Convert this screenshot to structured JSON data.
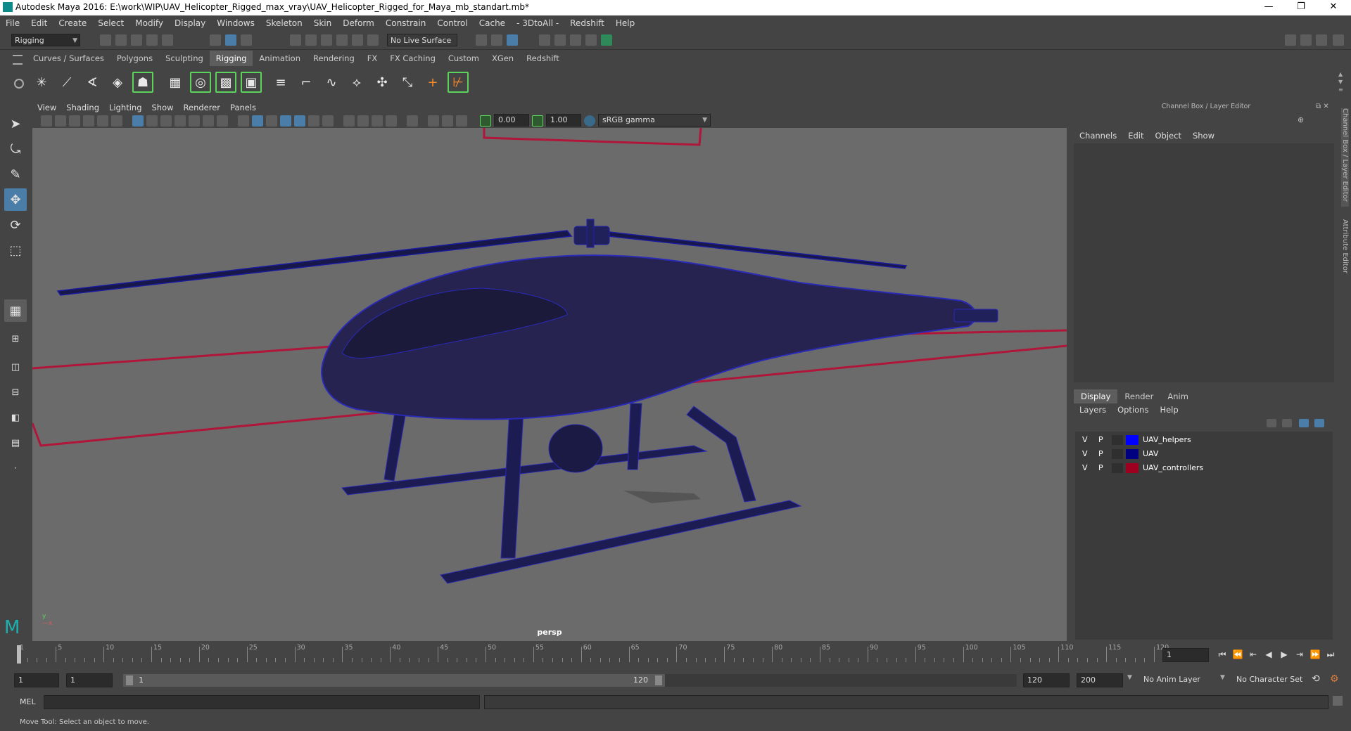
{
  "window": {
    "title": "Autodesk Maya 2016: E:\\work\\WIP\\UAV_Helicopter_Rigged_max_vray\\UAV_Helicopter_Rigged_for_Maya_mb_standart.mb*",
    "minimize": "—",
    "restore": "❐",
    "close": "✕"
  },
  "menubar": [
    "File",
    "Edit",
    "Create",
    "Select",
    "Modify",
    "Display",
    "Windows",
    "Skeleton",
    "Skin",
    "Deform",
    "Constrain",
    "Control",
    "Cache",
    "- 3DtoAll -",
    "Redshift",
    "Help"
  ],
  "statusline": {
    "menuset": "Rigging",
    "live_surface": "No Live Surface"
  },
  "shelf": {
    "tabs": [
      "Curves / Surfaces",
      "Polygons",
      "Sculpting",
      "Rigging",
      "Animation",
      "Rendering",
      "FX",
      "FX Caching",
      "Custom",
      "XGen",
      "Redshift"
    ],
    "active_tab": "Rigging"
  },
  "viewport": {
    "menu": [
      "View",
      "Shading",
      "Lighting",
      "Show",
      "Renderer",
      "Panels"
    ],
    "exposure": "0.00",
    "gamma": "1.00",
    "color_space": "sRGB gamma",
    "camera_label": "persp"
  },
  "channel_box": {
    "title": "Channel Box / Layer Editor",
    "menu": [
      "Channels",
      "Edit",
      "Object",
      "Show"
    ]
  },
  "layer_editor": {
    "tabs": [
      "Display",
      "Render",
      "Anim"
    ],
    "active_tab": "Display",
    "menu": [
      "Layers",
      "Options",
      "Help"
    ],
    "layers": [
      {
        "v": "V",
        "p": "P",
        "color": "#0000ff",
        "name": "UAV_helpers"
      },
      {
        "v": "V",
        "p": "P",
        "color": "#000080",
        "name": "UAV"
      },
      {
        "v": "V",
        "p": "P",
        "color": "#a00020",
        "name": "UAV_controllers"
      }
    ]
  },
  "side_tabs": {
    "channel_box": "Channel Box / Layer Editor",
    "attribute_editor": "Attribute Editor"
  },
  "timeline": {
    "ticks": [
      "1",
      "5",
      "10",
      "15",
      "20",
      "25",
      "30",
      "35",
      "40",
      "45",
      "50",
      "55",
      "60",
      "65",
      "70",
      "75",
      "80",
      "85",
      "90",
      "95",
      "100",
      "105",
      "110",
      "115",
      "120"
    ],
    "current_frame": "1"
  },
  "range": {
    "start": "1",
    "anim_start": "1",
    "range_start_label": "1",
    "range_end_label": "120",
    "end": "120",
    "anim_end": "200",
    "anim_layer": "No Anim Layer",
    "character_set": "No Character Set"
  },
  "command_line": {
    "label": "MEL"
  },
  "help_line": "Move Tool: Select an object to move."
}
